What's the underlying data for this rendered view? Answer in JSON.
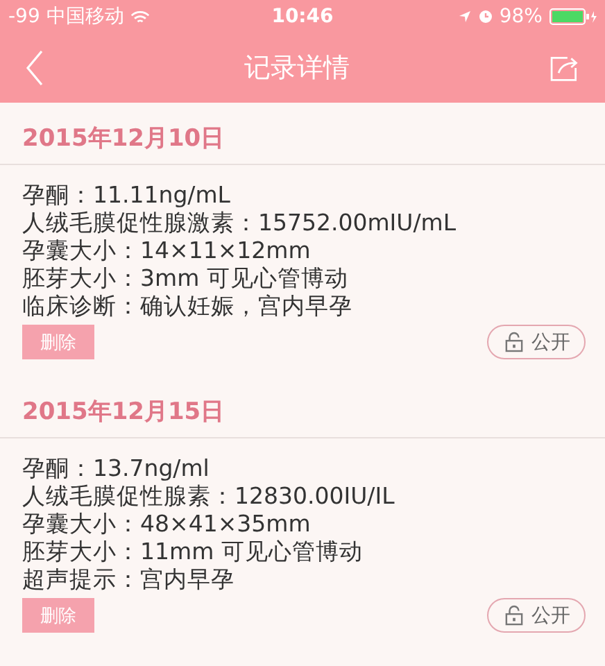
{
  "status_bar": {
    "carrier": "-99 中国移动",
    "time": "10:46",
    "battery": "98%"
  },
  "nav": {
    "title": "记录详情"
  },
  "records": [
    {
      "date": "2015年12月10日",
      "lines": [
        "孕酮：11.11ng/mL",
        "人绒毛膜促性腺激素：15752.00mIU/mL",
        "孕囊大小：14×11×12mm",
        "胚芽大小：3mm 可见心管博动",
        "临床诊断：确认妊娠，宫内早孕"
      ],
      "delete": "删除",
      "visibility": "公开"
    },
    {
      "date": "2015年12月15日",
      "lines": [
        "孕酮：13.7ng/ml",
        "人绒毛膜促性腺素：12830.00IU/IL",
        "孕囊大小：48×41×35mm",
        "胚芽大小：11mm 可见心管博动",
        "超声提示：宫内早孕"
      ],
      "delete": "删除",
      "visibility": "公开"
    }
  ]
}
